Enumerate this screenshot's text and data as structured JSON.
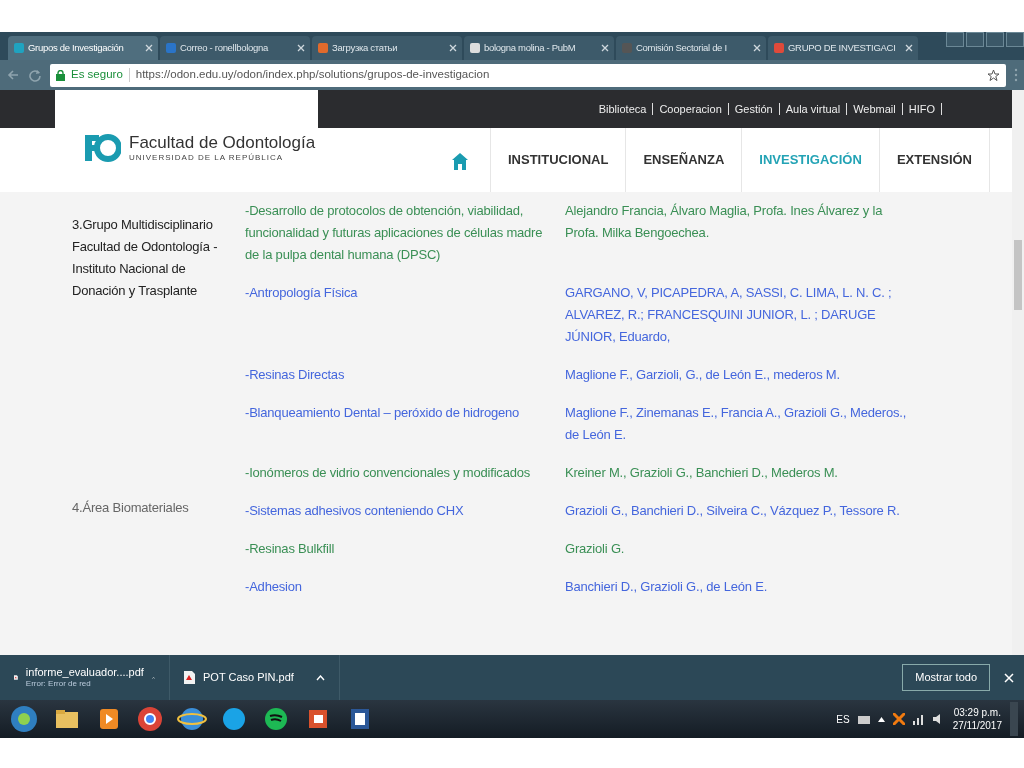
{
  "browser": {
    "tabs": [
      {
        "label": "Grupos de Investigación",
        "selected": true
      },
      {
        "label": "Correo - ronellbologna",
        "selected": false
      },
      {
        "label": "Загрузка статьи",
        "selected": false
      },
      {
        "label": "bologna molina - PubM",
        "selected": false
      },
      {
        "label": "Comisión Sectorial de I",
        "selected": false
      },
      {
        "label": "GRUPO DE INVESTIGACI",
        "selected": false
      }
    ],
    "secure_label": "Es seguro",
    "url": "https://odon.edu.uy/odon/index.php/solutions/grupos-de-investigacion"
  },
  "site": {
    "top_links": [
      "Biblioteca",
      "Cooperacion",
      "Gestión",
      "Aula virtual",
      "Webmail",
      "HIFO"
    ],
    "logo": {
      "name": "Facultad de Odontología",
      "subtitle": "UNIVERSIDAD DE LA REPÚBLICA"
    },
    "nav": [
      {
        "label": "INSTITUCIONAL",
        "selected": false
      },
      {
        "label": "ENSEÑANZA",
        "selected": false
      },
      {
        "label": "INVESTIGACIÓN",
        "selected": true
      },
      {
        "label": "EXTENSIÓN",
        "selected": false
      }
    ]
  },
  "groups": [
    {
      "label": "3.Grupo Multidisciplinario Facultad de Odontología - Instituto Nacional de Donación y Trasplante",
      "rows": [
        {
          "topic": "-Desarrollo de protocolos de obtención, viabilidad, funcionalidad y futuras aplicaciones de células madre de la pulpa dental humana (DPSC)",
          "authors": "Alejandro Francia, Álvaro Maglia, Profa. Ines Álvarez y la Profa. Milka Bengoechea.",
          "color": "#3a8f55"
        },
        {
          "topic": "-Antropología Física",
          "authors": "GARGANO, V, PICAPEDRA, A, SASSI, C.  LIMA, L. N. C. ; ALVAREZ, R.; FRANCESQUINI JUNIOR, L. ; DARUGE JÚNIOR, Eduardo,",
          "color": "#4466dd"
        },
        {
          "topic": "-Resinas Directas",
          "authors": "Maglione F., Garzioli, G., de León E., mederos M.",
          "color": "#4466dd"
        },
        {
          "topic": "-Blanqueamiento Dental – peróxido de hidrogeno",
          "authors": "Maglione F., Zinemanas E., Francia A., Grazioli G., Mederos., de León E.",
          "color": "#4466dd"
        }
      ]
    },
    {
      "label": "4.Área Biomateriales",
      "rows": [
        {
          "topic": "-Ionómeros de vidrio convencionales y modificados",
          "authors": "Kreiner M., Grazioli G., Banchieri D., Mederos M.",
          "color": "#3a8f55"
        },
        {
          "topic": "-Sistemas adhesivos conteniendo CHX",
          "authors": "Grazioli G., Banchieri D., Silveira C., Vázquez P., Tessore R.",
          "color": "#4466dd"
        },
        {
          "topic": "-Resinas Bulkfill",
          "authors": "Grazioli G.",
          "color": "#3a8f55"
        },
        {
          "topic": "-Adhesion",
          "authors": "Banchieri D., Grazioli G., de León E.",
          "color": "#4466dd"
        }
      ]
    }
  ],
  "downloads": {
    "items": [
      {
        "file": "informe_evaluador....pdf",
        "status": "Error: Error de red"
      },
      {
        "file": "POT Caso PIN.pdf"
      }
    ],
    "show_all": "Mostrar todo"
  },
  "taskbar": {
    "language": "ES",
    "time": "03:29 p.m.",
    "date": "27/11/2017"
  }
}
